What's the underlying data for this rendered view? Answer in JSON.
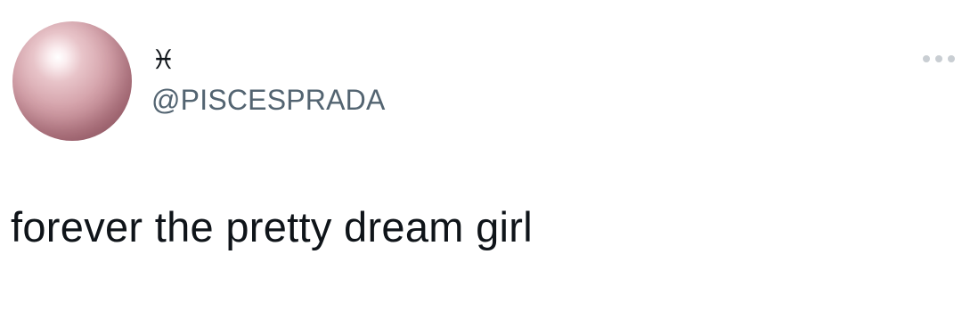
{
  "tweet": {
    "author": {
      "display_name": "♓︎",
      "handle": "@PISCESPRADA",
      "avatar_icon": "pink-pearl-avatar"
    },
    "more_icon": "more-horizontal-icon",
    "text": "forever the pretty dream girl"
  },
  "colors": {
    "text_primary": "#0f1419",
    "text_secondary": "#536471",
    "more_dots": "#c9ced3"
  }
}
